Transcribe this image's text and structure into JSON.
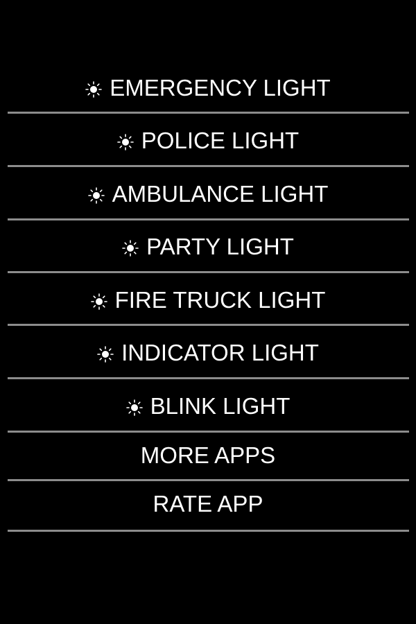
{
  "menu": {
    "items": [
      {
        "label": "EMERGENCY LIGHT",
        "icon": "light-bulb-icon"
      },
      {
        "label": "POLICE LIGHT",
        "icon": "light-bulb-icon"
      },
      {
        "label": "AMBULANCE LIGHT",
        "icon": "light-bulb-icon"
      },
      {
        "label": "PARTY LIGHT",
        "icon": "light-bulb-icon"
      },
      {
        "label": "FIRE TRUCK LIGHT",
        "icon": "light-bulb-icon"
      },
      {
        "label": "INDICATOR LIGHT",
        "icon": "light-bulb-icon"
      },
      {
        "label": "BLINK LIGHT",
        "icon": "light-bulb-icon"
      },
      {
        "label": "MORE APPS",
        "icon": null
      },
      {
        "label": "RATE APP",
        "icon": null
      }
    ]
  },
  "colors": {
    "background": "#000000",
    "text": "#ffffff",
    "divider": "#8c8c8c"
  }
}
